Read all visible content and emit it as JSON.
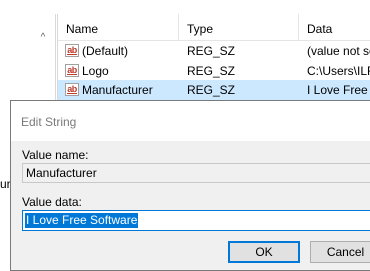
{
  "tree": {
    "scroll_up_glyph": "^",
    "partial_item": "urer"
  },
  "list": {
    "columns": [
      "Name",
      "Type",
      "Data"
    ],
    "rows": [
      {
        "icon": "ab",
        "name": "(Default)",
        "type": "REG_SZ",
        "data": "(value not set)",
        "selected": false
      },
      {
        "icon": "ab",
        "name": "Logo",
        "type": "REG_SZ",
        "data": "C:\\Users\\ILF",
        "selected": false
      },
      {
        "icon": "ab",
        "name": "Manufacturer",
        "type": "REG_SZ",
        "data": "I Love Free Software",
        "selected": true
      }
    ]
  },
  "dialog": {
    "title": "Edit String",
    "value_name_label": "Value name:",
    "value_name": "Manufacturer",
    "value_data_label": "Value data:",
    "value_data": "I Love Free Software",
    "ok_label": "OK",
    "cancel_label": "Cancel"
  },
  "colors": {
    "selection": "#cce8ff",
    "accent": "#0078d7",
    "dialog_bg": "#f0f0f0"
  }
}
